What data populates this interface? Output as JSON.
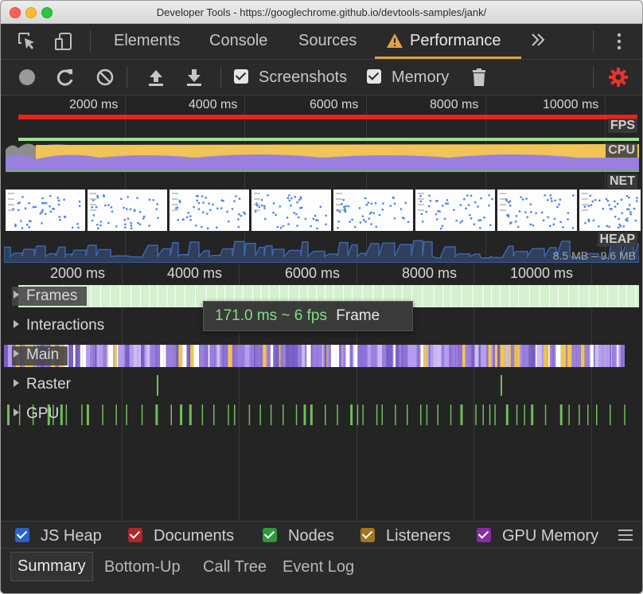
{
  "window": {
    "title": "Developer Tools - https://googlechrome.github.io/devtools-samples/jank/"
  },
  "tabs": {
    "items": [
      {
        "label": "Elements"
      },
      {
        "label": "Console"
      },
      {
        "label": "Sources"
      },
      {
        "label": "Performance",
        "active": true
      }
    ],
    "more_icon": "chevron-double-right-icon"
  },
  "toolbar": {
    "screenshots_label": "Screenshots",
    "screenshots_checked": true,
    "memory_label": "Memory",
    "memory_checked": true,
    "icons": [
      "record-icon",
      "reload-icon",
      "clear-icon",
      "upload-icon",
      "download-icon",
      "trash-icon",
      "settings-gear-icon"
    ]
  },
  "overview": {
    "ruler": [
      "2000 ms",
      "4000 ms",
      "6000 ms",
      "8000 ms",
      "10000 ms"
    ],
    "lanes": {
      "fps": "FPS",
      "cpu": "CPU",
      "net": "NET",
      "heap": "HEAP"
    },
    "heap_range": "8.5 MB – 9.6 MB"
  },
  "timeline": {
    "ruler": [
      "2000 ms",
      "4000 ms",
      "6000 ms",
      "8000 ms",
      "10000 ms"
    ],
    "tracks": {
      "frames": "Frames",
      "interactions": "Interactions",
      "main": "Main",
      "raster": "Raster",
      "gpu": "GPU"
    },
    "tooltip": {
      "fps": "171.0 ms ~ 6 fps",
      "type": "Frame"
    }
  },
  "counters": [
    {
      "label": "JS Heap",
      "color": "#2962c9"
    },
    {
      "label": "Documents",
      "color": "#b3262b"
    },
    {
      "label": "Nodes",
      "color": "#2e9a3a"
    },
    {
      "label": "Listeners",
      "color": "#a4741f"
    },
    {
      "label": "GPU Memory",
      "color": "#8a2aa5"
    }
  ],
  "bottom_tabs": [
    {
      "label": "Summary",
      "active": true
    },
    {
      "label": "Bottom-Up"
    },
    {
      "label": "Call Tree"
    },
    {
      "label": "Event Log"
    }
  ],
  "colors": {
    "accent_warning": "#e0a24a",
    "record_off": "#9a9a9a",
    "settings_active": "#e8332c",
    "fps_bad": "#e8231b",
    "cpu_scripting": "#f0c456",
    "cpu_rendering": "#9a7ee0",
    "frames": "#d5f1d0",
    "gpu": "#6fbf5a"
  }
}
